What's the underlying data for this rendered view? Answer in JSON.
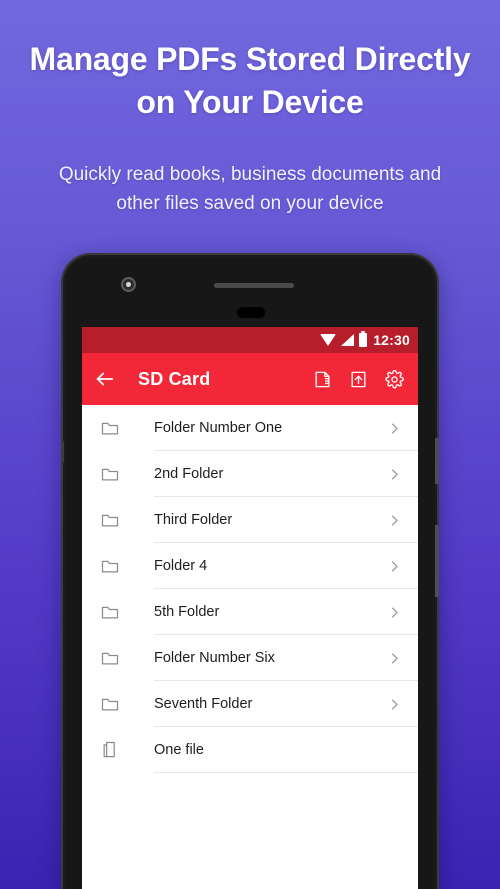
{
  "promo": {
    "headline": "Manage PDFs Stored Directly\non Your Device",
    "subhead": "Quickly read books, business documents and\nother files saved on your device"
  },
  "colors": {
    "bg_top": "#7169DE",
    "bg_bottom": "#3A23B2",
    "appbar": "#F22738",
    "statusbar": "#B81D2C",
    "phone_frame": "#1C1C1C",
    "screen": "#FFFFFF",
    "divider": "#E8E8E8",
    "row_text": "#1E1E1E",
    "row_icon": "#8C8C8C"
  },
  "phone": {
    "camera_icon": "front-camera",
    "speaker_icon": "earpiece-speaker",
    "sensor_icon": "proximity-sensor",
    "power_button": "power-button",
    "volume_button": "volume-rocker"
  },
  "statusbar": {
    "clock": "12:30",
    "icons": [
      "wifi-icon",
      "signal-icon",
      "battery-icon"
    ]
  },
  "appbar": {
    "back_icon": "back-arrow-icon",
    "title": "SD Card",
    "actions": [
      {
        "name": "page-flip-icon",
        "label": "Flip"
      },
      {
        "name": "upload-icon",
        "label": "Import"
      },
      {
        "name": "gear-icon",
        "label": "Settings"
      }
    ]
  },
  "list": {
    "chevron_icon": "chevron-right-icon",
    "items": [
      {
        "label": "Folder Number One",
        "icon": "folder-icon",
        "type": "folder",
        "chevron": true
      },
      {
        "label": "2nd Folder",
        "icon": "folder-icon",
        "type": "folder",
        "chevron": true
      },
      {
        "label": "Third Folder",
        "icon": "folder-icon",
        "type": "folder",
        "chevron": true
      },
      {
        "label": "Folder 4",
        "icon": "folder-icon",
        "type": "folder",
        "chevron": true
      },
      {
        "label": "5th Folder",
        "icon": "folder-icon",
        "type": "folder",
        "chevron": true
      },
      {
        "label": "Folder Number Six",
        "icon": "folder-icon",
        "type": "folder",
        "chevron": true
      },
      {
        "label": "Seventh Folder",
        "icon": "folder-icon",
        "type": "folder",
        "chevron": true
      },
      {
        "label": "One file",
        "icon": "file-icon",
        "type": "file",
        "chevron": false
      }
    ]
  }
}
